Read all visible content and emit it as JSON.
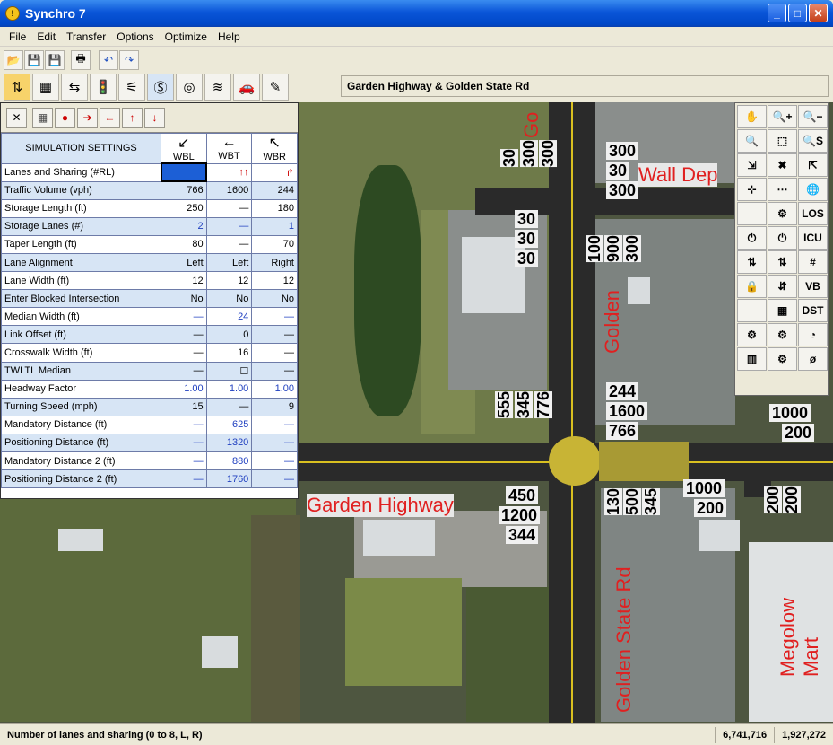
{
  "window": {
    "title": "Synchro 7",
    "minimize": "_",
    "maximize": "□",
    "close": "✕"
  },
  "menu": [
    "File",
    "Edit",
    "Transfer",
    "Options",
    "Optimize",
    "Help"
  ],
  "address": "Garden Highway & Golden State Rd",
  "panel": {
    "title": "SIMULATION SETTINGS",
    "cols": [
      "WBL",
      "WBT",
      "WBR"
    ],
    "rows": [
      {
        "label": "Lanes and Sharing (#RL)",
        "v": [
          "",
          "↑↑",
          "↱"
        ],
        "shade": false
      },
      {
        "label": "Traffic Volume (vph)",
        "v": [
          "766",
          "1600",
          "244"
        ],
        "shade": true
      },
      {
        "label": "Storage Length (ft)",
        "v": [
          "250",
          "—",
          "180"
        ],
        "shade": false
      },
      {
        "label": "Storage Lanes (#)",
        "v": [
          "2",
          "—",
          "1"
        ],
        "shade": true,
        "blue": true
      },
      {
        "label": "Taper Length (ft)",
        "v": [
          "80",
          "—",
          "70"
        ],
        "shade": false
      },
      {
        "label": "Lane Alignment",
        "v": [
          "Left",
          "Left",
          "Right"
        ],
        "shade": true
      },
      {
        "label": "Lane Width (ft)",
        "v": [
          "12",
          "12",
          "12"
        ],
        "shade": false
      },
      {
        "label": "Enter Blocked Intersection",
        "v": [
          "No",
          "No",
          "No"
        ],
        "shade": true
      },
      {
        "label": "Median Width (ft)",
        "v": [
          "—",
          "24",
          "—"
        ],
        "shade": false,
        "blue": true
      },
      {
        "label": "Link Offset (ft)",
        "v": [
          "—",
          "0",
          "—"
        ],
        "shade": true
      },
      {
        "label": "Crosswalk Width (ft)",
        "v": [
          "—",
          "16",
          "—"
        ],
        "shade": false
      },
      {
        "label": "TWLTL Median",
        "v": [
          "—",
          "☐",
          "—"
        ],
        "shade": true
      },
      {
        "label": "Headway Factor",
        "v": [
          "1.00",
          "1.00",
          "1.00"
        ],
        "shade": false,
        "blue": true
      },
      {
        "label": "Turning Speed (mph)",
        "v": [
          "15",
          "—",
          "9"
        ],
        "shade": true
      },
      {
        "label": "Mandatory Distance (ft)",
        "v": [
          "—",
          "625",
          "—"
        ],
        "shade": false,
        "blue": true
      },
      {
        "label": "Positioning Distance (ft)",
        "v": [
          "—",
          "1320",
          "—"
        ],
        "shade": true,
        "blue": true
      },
      {
        "label": "Mandatory Distance 2 (ft)",
        "v": [
          "—",
          "880",
          "—"
        ],
        "shade": false,
        "blue": true
      },
      {
        "label": "Positioning Distance 2 (ft)",
        "v": [
          "—",
          "1760",
          "—"
        ],
        "shade": true,
        "blue": true
      }
    ]
  },
  "righttools": [
    "✋",
    "🔍+",
    "🔍−",
    "🔍",
    "⬚",
    "🔍S",
    "⇲",
    "✖",
    "⇱",
    "⊹",
    "⋯",
    "🌐",
    "",
    "⚙",
    "LOS",
    "⏻",
    "⏻",
    "ICU",
    "⇅",
    "⇅",
    "#",
    "🔒",
    "⇵",
    "VB",
    "",
    "▦",
    "DST",
    "⚙",
    "⚙",
    "◔",
    "▥",
    "⚙",
    "ø"
  ],
  "map": {
    "streets": [
      "Garden Highway",
      "Golden",
      "Golden State Rd",
      "Wall Dep",
      "Megolow Mart",
      "Go"
    ],
    "volumes": [
      "300",
      "30",
      "300",
      "30",
      "30",
      "30",
      "555",
      "345",
      "776",
      "244",
      "1600",
      "766",
      "1000",
      "200",
      "450",
      "1200",
      "344",
      "1000",
      "200",
      "130",
      "500",
      "345",
      "200",
      "200",
      "100",
      "900",
      "300",
      "30",
      "300",
      "300"
    ]
  },
  "status": {
    "text": "Number of lanes and sharing (0 to 8, L, R)",
    "x": "6,741,716",
    "y": "1,927,272"
  }
}
